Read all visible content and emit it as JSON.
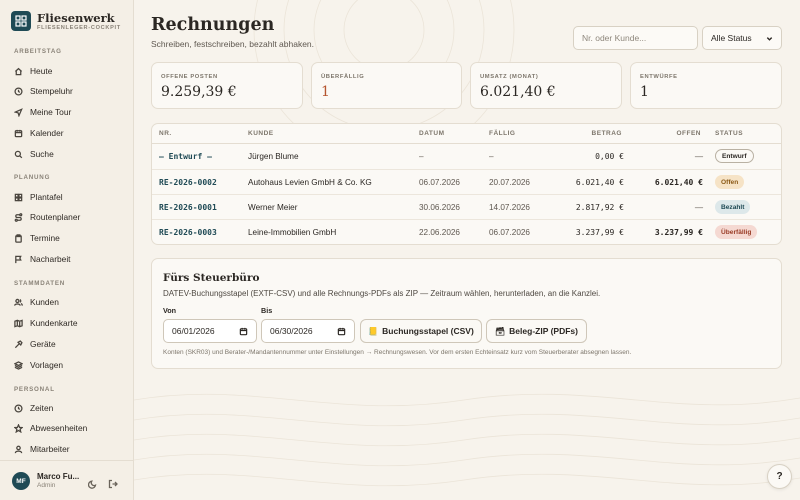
{
  "brand": {
    "name": "Fliesenwerk",
    "subtitle": "FLIESENLEGER-COCKPIT"
  },
  "sidebar": {
    "sections": [
      {
        "label": "ARBEITSTAG",
        "items": [
          {
            "label": "Heute",
            "icon": "home-icon"
          },
          {
            "label": "Stempeluhr",
            "icon": "clock-icon"
          },
          {
            "label": "Meine Tour",
            "icon": "navigation-icon"
          },
          {
            "label": "Kalender",
            "icon": "calendar-icon"
          },
          {
            "label": "Suche",
            "icon": "search-icon"
          }
        ]
      },
      {
        "label": "PLANUNG",
        "items": [
          {
            "label": "Plantafel",
            "icon": "grid-icon"
          },
          {
            "label": "Routenplaner",
            "icon": "route-icon"
          },
          {
            "label": "Termine",
            "icon": "clipboard-icon"
          },
          {
            "label": "Nacharbeit",
            "icon": "flag-icon"
          }
        ]
      },
      {
        "label": "STAMMDATEN",
        "items": [
          {
            "label": "Kunden",
            "icon": "users-icon"
          },
          {
            "label": "Kundenkarte",
            "icon": "map-icon"
          },
          {
            "label": "Geräte",
            "icon": "hammer-icon"
          },
          {
            "label": "Vorlagen",
            "icon": "layers-icon"
          }
        ]
      },
      {
        "label": "PERSONAL",
        "items": [
          {
            "label": "Zeiten",
            "icon": "clock-icon"
          },
          {
            "label": "Abwesenheiten",
            "icon": "star-icon"
          },
          {
            "label": "Mitarbeiter",
            "icon": "user-icon"
          }
        ]
      }
    ],
    "user": {
      "initials": "MF",
      "name": "Marco Fu...",
      "role": "Admin"
    }
  },
  "page": {
    "title": "Rechnungen",
    "subtitle": "Schreiben, festschreiben, bezahlt abhaken."
  },
  "search": {
    "placeholder": "Nr. oder Kunde..."
  },
  "status_filter": {
    "selected": "Alle Status"
  },
  "kpis": [
    {
      "label": "OFFENE POSTEN",
      "value": "9.259,39 €"
    },
    {
      "label": "ÜBERFÄLLIG",
      "value": "1"
    },
    {
      "label": "UMSATZ (MONAT)",
      "value": "6.021,40 €"
    },
    {
      "label": "ENTWÜRFE",
      "value": "1"
    }
  ],
  "table": {
    "headers": {
      "nr": "NR.",
      "kunde": "KUNDE",
      "datum": "DATUM",
      "faellig": "FÄLLIG",
      "betrag": "BETRAG",
      "offen": "OFFEN",
      "status": "STATUS"
    },
    "rows": [
      {
        "nr": "— Entwurf —",
        "kunde": "Jürgen Blume",
        "datum": "–",
        "faellig": "–",
        "betrag": "0,00 €",
        "offen": "—",
        "status": "Entwurf"
      },
      {
        "nr": "RE-2026-0002",
        "kunde": "Autohaus Levien GmbH & Co. KG",
        "datum": "06.07.2026",
        "faellig": "20.07.2026",
        "betrag": "6.021,40 €",
        "offen": "6.021,40 €",
        "status": "Offen"
      },
      {
        "nr": "RE-2026-0001",
        "kunde": "Werner Meier",
        "datum": "30.06.2026",
        "faellig": "14.07.2026",
        "betrag": "2.817,92 €",
        "offen": "—",
        "status": "Bezahlt"
      },
      {
        "nr": "RE-2026-0003",
        "kunde": "Leine-Immobilien GmbH",
        "datum": "22.06.2026",
        "faellig": "06.07.2026",
        "betrag": "3.237,99 €",
        "offen": "3.237,99 €",
        "status": "Überfällig"
      }
    ]
  },
  "tax": {
    "title": "Fürs Steuerbüro",
    "description": "DATEV-Buchungsstapel (EXTF-CSV) und alle Rechnungs-PDFs als ZIP — Zeitraum wählen, herunterladen, an die Kanzlei.",
    "from_label": "Von",
    "from_value": "06/01/2026",
    "to_label": "Bis",
    "to_value": "06/30/2026",
    "csv_button": "Buchungsstapel (CSV)",
    "zip_button": "Beleg-ZIP (PDFs)",
    "note": "Konten (SKR03) und Berater-/Mandantennummer unter Einstellungen → Rechnungswesen. Vor dem ersten Echteinsatz kurz vom Steuerberater absegnen lassen."
  },
  "help": {
    "label": "?"
  },
  "colors": {
    "accent": "#1f4a55",
    "background": "#f7f3ec",
    "overdue": "#b5552f"
  }
}
